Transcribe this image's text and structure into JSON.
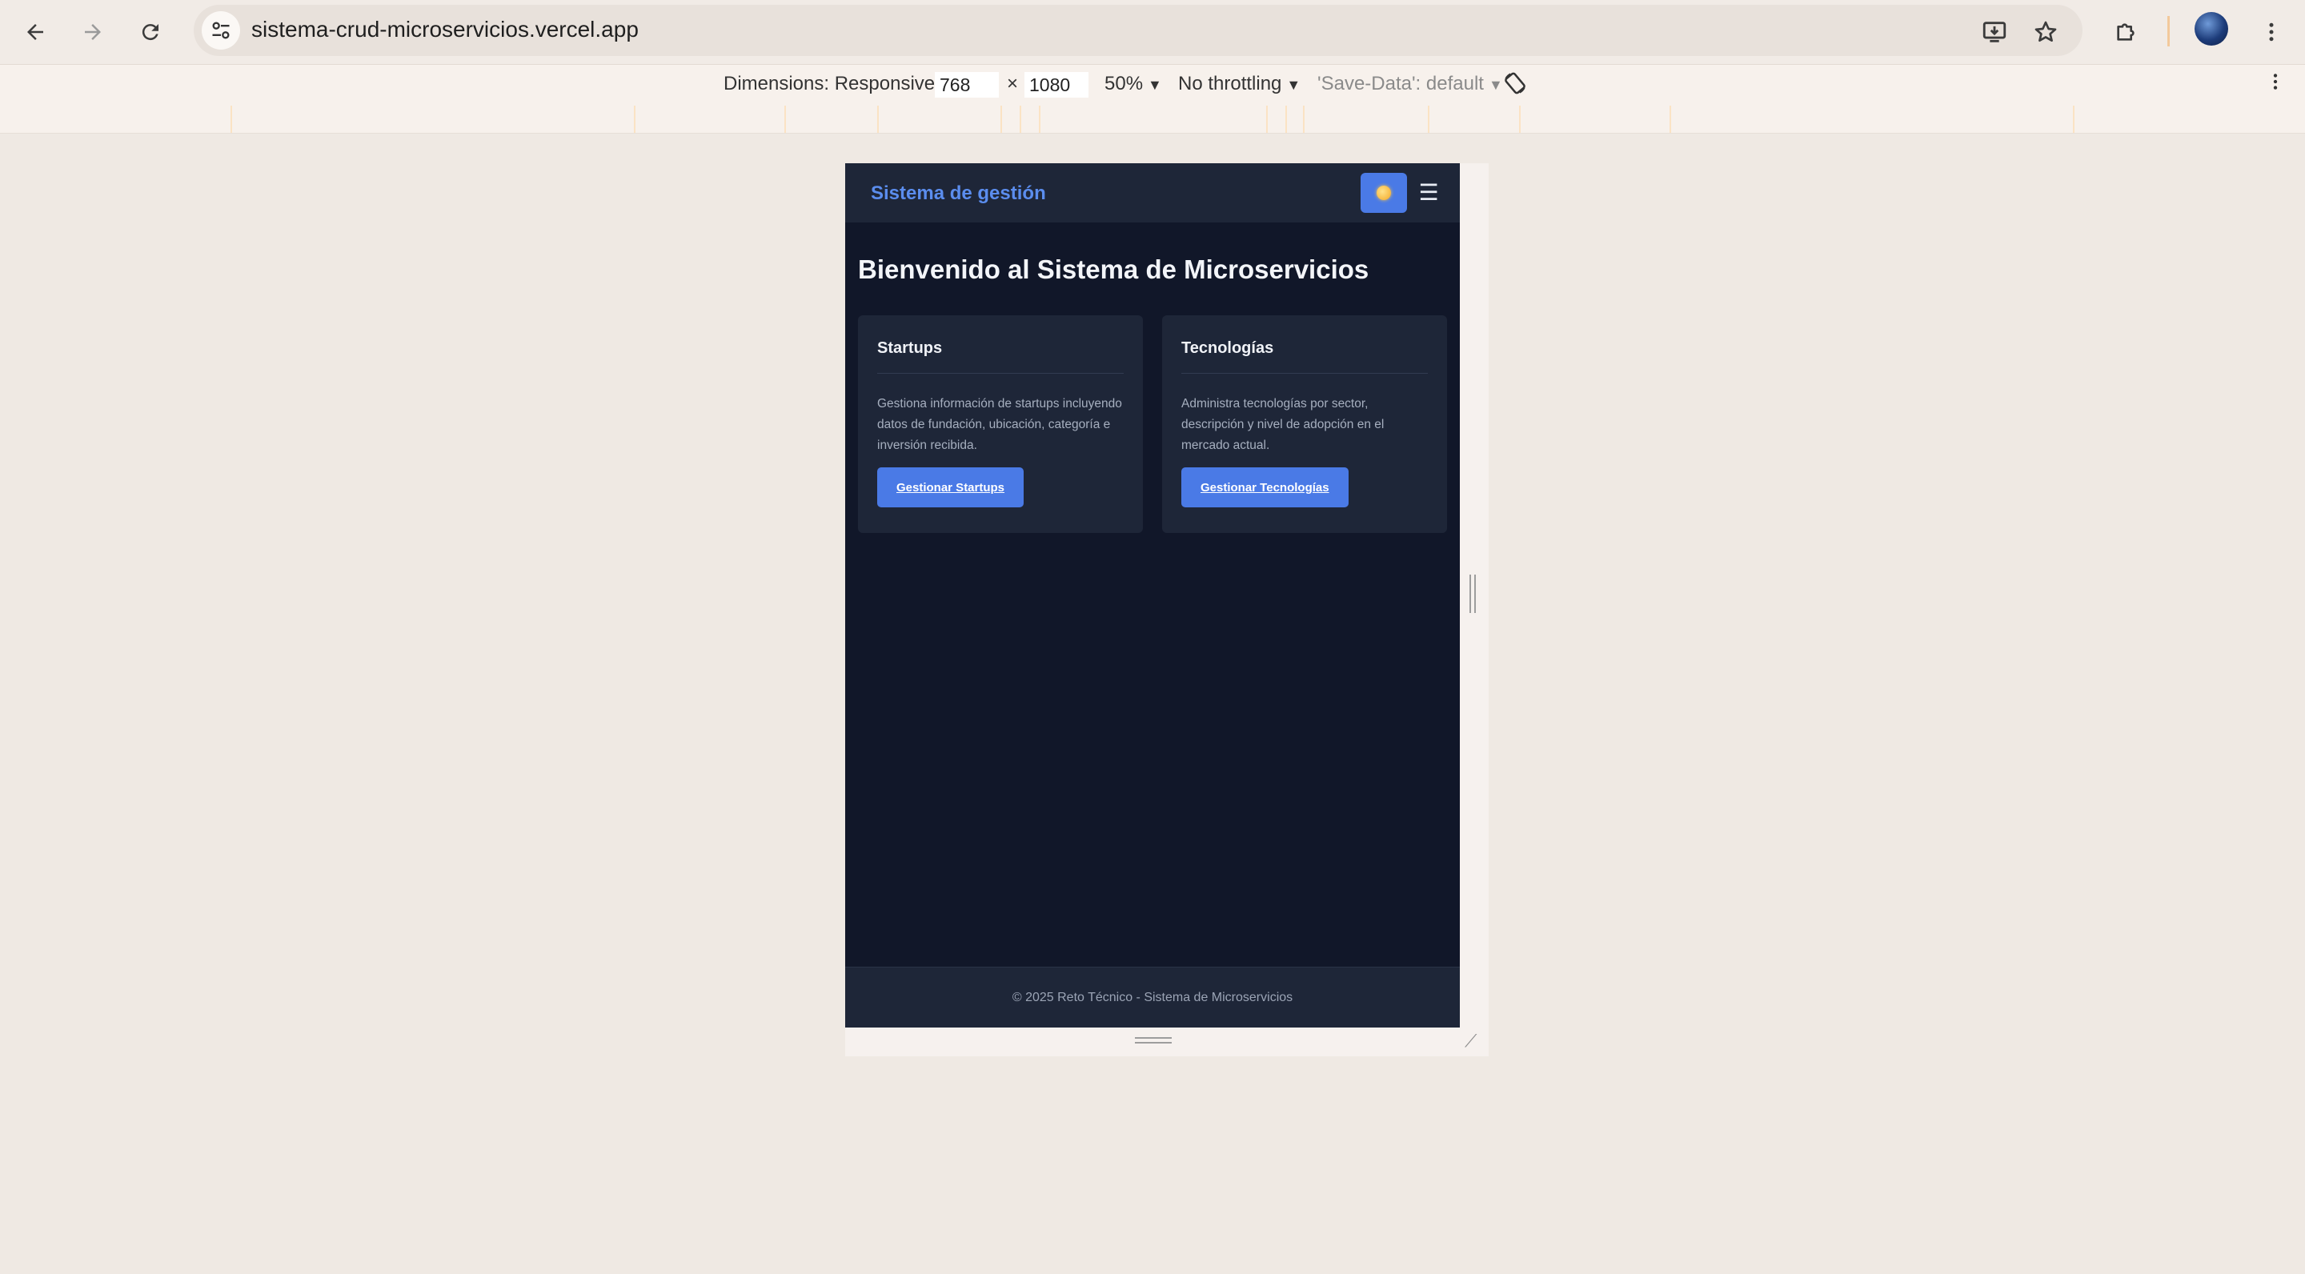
{
  "browser": {
    "url": "sistema-crud-microservicios.vercel.app",
    "icons": {
      "back": "arrow-left-icon",
      "forward": "arrow-right-icon",
      "reload": "reload-icon",
      "site_info": "tune-icon",
      "install": "install-app-icon",
      "bookmark": "star-icon",
      "extensions": "puzzle-icon",
      "menu": "kebab-menu-icon"
    }
  },
  "devtools": {
    "dimensions_label": "Dimensions: Responsive",
    "width": "768",
    "times": "×",
    "height": "1080",
    "zoom": "50%",
    "throttling": "No throttling",
    "save_data": "'Save-Data': default"
  },
  "app": {
    "brand": "Sistema de gestión",
    "menu_glyph": "☰",
    "page_title": "Bienvenido al Sistema de Microservicios",
    "cards": [
      {
        "title": "Startups",
        "description": "Gestiona información de startups incluyendo datos de fundación, ubicación, categoría e inversión recibida.",
        "button": "Gestionar Startups"
      },
      {
        "title": "Tecnologías",
        "description": "Administra tecnologías por sector, descripción y nivel de adopción en el mercado actual.",
        "button": "Gestionar Tecnologías"
      }
    ],
    "footer": "© 2025 Reto Técnico - Sistema de Microservicios"
  },
  "colors": {
    "page_bg": "#111729",
    "surface": "#1e2638",
    "accent": "#4a7ae6",
    "brand": "#5b8dee"
  }
}
